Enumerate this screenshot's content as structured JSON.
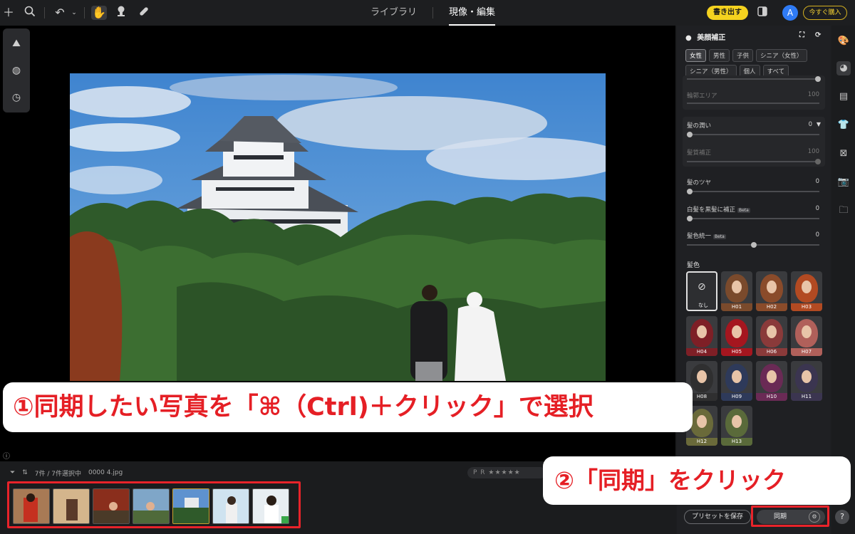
{
  "topbar": {
    "tabs": [
      {
        "label": "ライブラリ",
        "active": false
      },
      {
        "label": "現像・編集",
        "active": true
      }
    ],
    "export_label": "書き出す",
    "avatar_initial": "A",
    "buy_label": "今すぐ購入"
  },
  "filmstrip": {
    "count_text": "7件 / 7件選択中",
    "filename": "0000 4.jpg",
    "rating_flags": "P R ★★★★★"
  },
  "panel": {
    "title": "美顔補正",
    "chips": [
      {
        "label": "女性",
        "selected": true
      },
      {
        "label": "男性",
        "selected": false
      },
      {
        "label": "子供",
        "selected": false
      },
      {
        "label": "シニア（女性）",
        "selected": false
      },
      {
        "label": "シニア（男性）",
        "selected": false
      },
      {
        "label": "個人",
        "selected": false
      },
      {
        "label": "すべて",
        "selected": false
      }
    ],
    "sliders": {
      "area": {
        "label": "輪郭エリア",
        "value": "100"
      },
      "hair_moist": {
        "label": "髪の潤い",
        "value": "0"
      },
      "hair_quality": {
        "label": "髪質補正",
        "value": "100"
      },
      "hair_gloss": {
        "label": "髪のツヤ",
        "value": "0"
      },
      "gray_to_black": {
        "label": "白髪を黒髪に補正",
        "value": "0"
      },
      "hair_unify": {
        "label": "髪色統一",
        "value": "0"
      }
    },
    "beta_label": "Beta",
    "hair_color_title": "髪色",
    "swatch_none_label": "なし",
    "swatches": [
      {
        "label": "H01",
        "color": "#7a4a2c"
      },
      {
        "label": "H02",
        "color": "#8a4b2a"
      },
      {
        "label": "H03",
        "color": "#b24a22"
      },
      {
        "label": "H04",
        "color": "#7e1f26"
      },
      {
        "label": "H05",
        "color": "#a5161f"
      },
      {
        "label": "H06",
        "color": "#8a3a3a"
      },
      {
        "label": "H07",
        "color": "#b0605a"
      },
      {
        "label": "H08",
        "color": "#2f2f30"
      },
      {
        "label": "H09",
        "color": "#2e3a5a"
      },
      {
        "label": "H10",
        "color": "#6a2a55"
      },
      {
        "label": "H11",
        "color": "#3b3550"
      },
      {
        "label": "H12",
        "color": "#6a6a3a"
      },
      {
        "label": "H13",
        "color": "#5a6a3a"
      }
    ],
    "preset_label": "プリセットを保存",
    "sync_label": "同期"
  },
  "callouts": {
    "step1": "①同期したい写真を「⌘（Ctrl)＋クリック」で選択",
    "step2": "②「同期」をクリック"
  },
  "colors": {
    "accent_red": "#e8232a",
    "export_yellow": "#f4d21f",
    "avatar_blue": "#2f7bf5"
  }
}
